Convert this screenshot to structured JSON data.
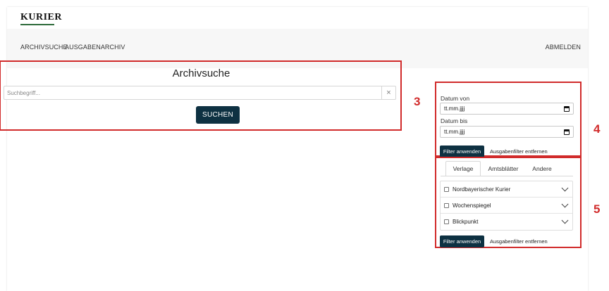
{
  "header": {
    "logo": "KURIER"
  },
  "nav": {
    "archivsuche": "ARCHIVSUCHE",
    "ausgabenarchiv": "AUSGABENARCHIV",
    "logout": "ABMELDEN"
  },
  "search": {
    "title": "Archivsuche",
    "placeholder": "Suchbegriff...",
    "clear_icon": "×",
    "button": "SUCHEN"
  },
  "date_filter": {
    "from_label": "Datum von",
    "from_value": "tt.mm.jjjj",
    "to_label": "Datum bis",
    "to_value": "tt.mm.jjjj",
    "apply": "Filter anwenden",
    "clear": "Ausgabenfilter entfernen"
  },
  "publication_filter": {
    "tabs": [
      "Verlage",
      "Amtsblätter",
      "Andere"
    ],
    "active_tab": "Verlage",
    "items": [
      {
        "label": "Nordbayerischer Kurier"
      },
      {
        "label": "Wochenspiegel"
      },
      {
        "label": "Blickpunkt"
      }
    ],
    "apply": "Filter anwenden",
    "clear": "Ausgabenfilter entfernen"
  },
  "annotations": {
    "a3": "3",
    "a4": "4",
    "a5": "5"
  },
  "colors": {
    "primary_button": "#0e3142",
    "annotation": "#d12b2b",
    "logo_underline": "#2e6b3a"
  }
}
